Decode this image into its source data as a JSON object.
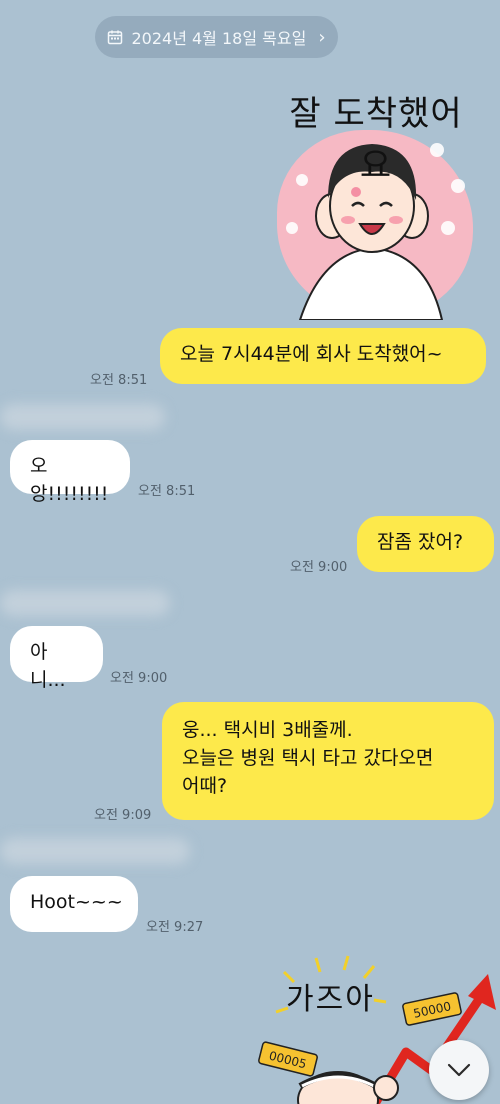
{
  "date_separator": {
    "label": "2024년 4월 18일 목요일",
    "icon": "calendar-icon",
    "chevron": "›"
  },
  "messages": [
    {
      "id": "m1",
      "kind": "sticker",
      "side": "out",
      "caption": "잘 도착했어요"
    },
    {
      "id": "m2",
      "side": "out",
      "text": "오늘 7시44분에 회사 도착했어~",
      "time": "오전 8:51"
    },
    {
      "id": "m3",
      "side": "in",
      "text": "오앙!!!!!!!!",
      "time": "오전 8:51"
    },
    {
      "id": "m4",
      "side": "out",
      "text": "잠좀 잤어?",
      "time": "오전 9:00"
    },
    {
      "id": "m5",
      "side": "in",
      "text": "아니...",
      "time": "오전 9:00"
    },
    {
      "id": "m6",
      "side": "out",
      "lines": [
        "웅... 택시비 3배줄께.",
        "오늘은 병원 택시 타고 갔다오면",
        "어때?"
      ],
      "time": "오전 9:09"
    },
    {
      "id": "m7",
      "side": "in",
      "text": "Hoot~~~",
      "time": "오전 9:27"
    },
    {
      "id": "m8",
      "kind": "sticker",
      "side": "out",
      "caption": "가즈아",
      "sign_values": [
        "50000",
        "00005"
      ]
    }
  ],
  "colors": {
    "background": "#abc1d1",
    "outgoing": "#fde94b",
    "incoming": "#ffffff",
    "date_pill": "#95abbd"
  },
  "scroll_button": {
    "icon": "chevron-down-icon"
  }
}
